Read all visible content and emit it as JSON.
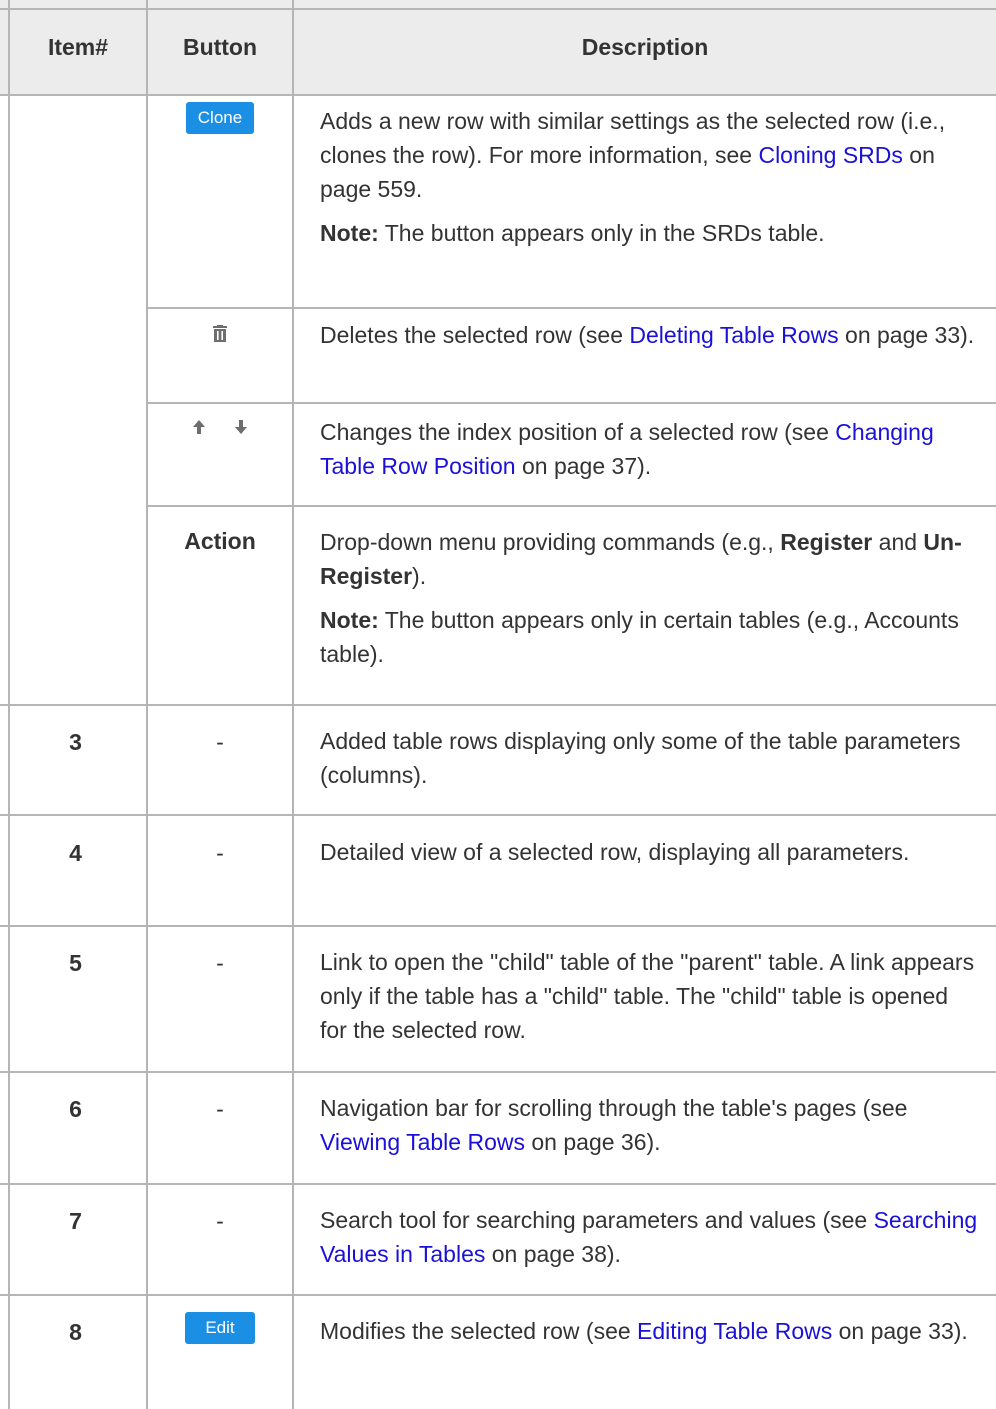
{
  "header": {
    "item": "Item#",
    "button": "Button",
    "description": "Description"
  },
  "rows": {
    "clone": {
      "button_label": "Clone",
      "desc_1": "Adds a new row with similar settings as the selected row (i.e., clones the row). For more information, see ",
      "link": "Cloning SRDs",
      "desc_2": " on page 559.",
      "note_label": "Note:",
      "note_text": " The button appears only in the SRDs table."
    },
    "delete": {
      "icon": "trash-icon",
      "desc_1": "Deletes the selected row (see ",
      "link": "Deleting Table Rows",
      "desc_2": " on page 33)."
    },
    "move": {
      "icons": [
        "arrow-up-icon",
        "arrow-down-icon"
      ],
      "desc_1": "Changes the index position of a selected row (see ",
      "link": "Changing Table Row Position",
      "desc_2": " on page 37)."
    },
    "action": {
      "button_label": "Action",
      "desc_1": "Drop-down menu providing commands (e.g., ",
      "bold_1": "Register",
      "desc_2": " and ",
      "bold_2": "Un-Register",
      "desc_3": ").",
      "note_label": "Note:",
      "note_text": " The button appears only in certain tables (e.g., Accounts table)."
    },
    "r3": {
      "item": "3",
      "button": "-",
      "desc": "Added table rows displaying only some of the table parameters (columns)."
    },
    "r4": {
      "item": "4",
      "button": "-",
      "desc": "Detailed view of a selected row, displaying all parameters."
    },
    "r5": {
      "item": "5",
      "button": "-",
      "desc": "Link to open the \"child\" table of the \"parent\" table. A link appears only if the table has a \"child\" table. The \"child\" table is opened for the selected row."
    },
    "r6": {
      "item": "6",
      "button": "-",
      "desc_1": "Navigation bar for scrolling through the table's pages (see ",
      "link": "Viewing Table Rows",
      "desc_2": " on page 36)."
    },
    "r7": {
      "item": "7",
      "button": "-",
      "desc_1": "Search tool for searching parameters and values (see ",
      "link": "Searching Values in Tables",
      "desc_2": " on page 38)."
    },
    "r8": {
      "item": "8",
      "button_label": "Edit",
      "desc_1": "Modifies the selected row (see ",
      "link": "Editing Table Rows",
      "desc_2": " on page 33)."
    }
  },
  "colors": {
    "link": "#1a10d8",
    "button_bg": "#1a8fe3",
    "header_bg": "#ececec",
    "grid": "#b5b5b5"
  }
}
